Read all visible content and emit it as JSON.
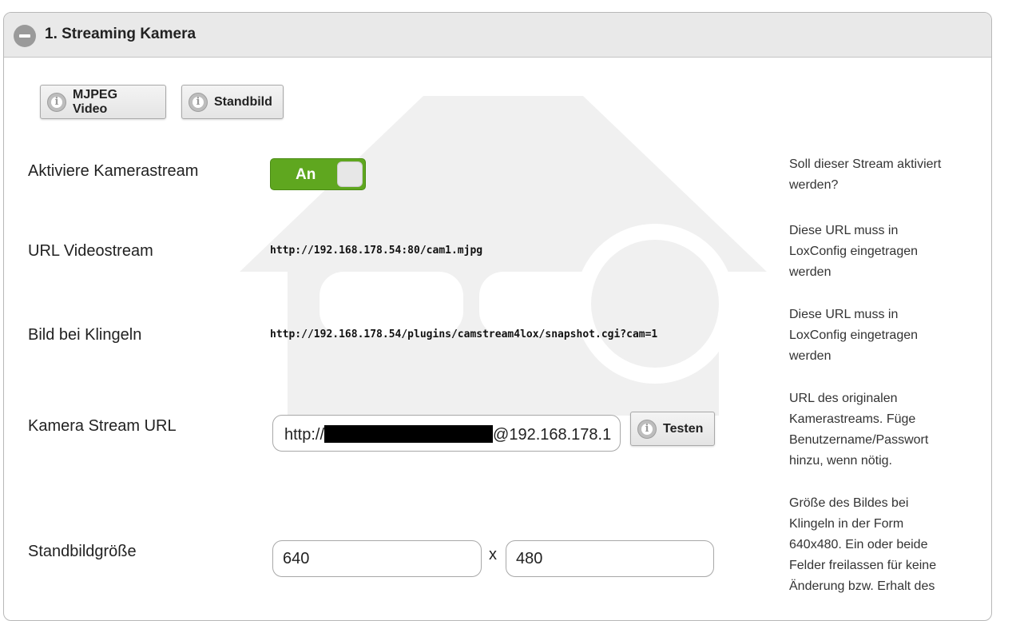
{
  "panel": {
    "title": "1. Streaming Kamera"
  },
  "buttons": {
    "mjpeg": "MJPEG Video",
    "standbild": "Standbild",
    "testen": "Testen"
  },
  "rows": {
    "activate": {
      "label": "Aktiviere Kamerastream",
      "toggle_text": "An",
      "help": "Soll dieser Stream aktiviert werden?"
    },
    "video_url": {
      "label": "URL Videostream",
      "value": "http://192.168.178.54:80/cam1.mjpg",
      "help": "Diese URL muss in LoxConfig eingetragen werden"
    },
    "ring_image": {
      "label": "Bild bei Klingeln",
      "value": "http://192.168.178.54/plugins/camstream4lox/snapshot.cgi?cam=1",
      "help": "Diese URL muss in LoxConfig eingetragen werden"
    },
    "camera_url": {
      "label": "Kamera Stream URL",
      "prefix": "http://",
      "suffix": "@192.168.178.1",
      "help": "URL des originalen Kamerastreams. Füge Benutzername/Passwort hinzu, wenn nötig."
    },
    "image_size": {
      "label": "Standbildgröße",
      "width": "640",
      "separator": "x",
      "height": "480",
      "help": "Größe des Bildes bei Klingeln in der Form 640x480. Ein oder beide Felder freilassen für keine Änderung bzw. Erhalt des"
    }
  }
}
